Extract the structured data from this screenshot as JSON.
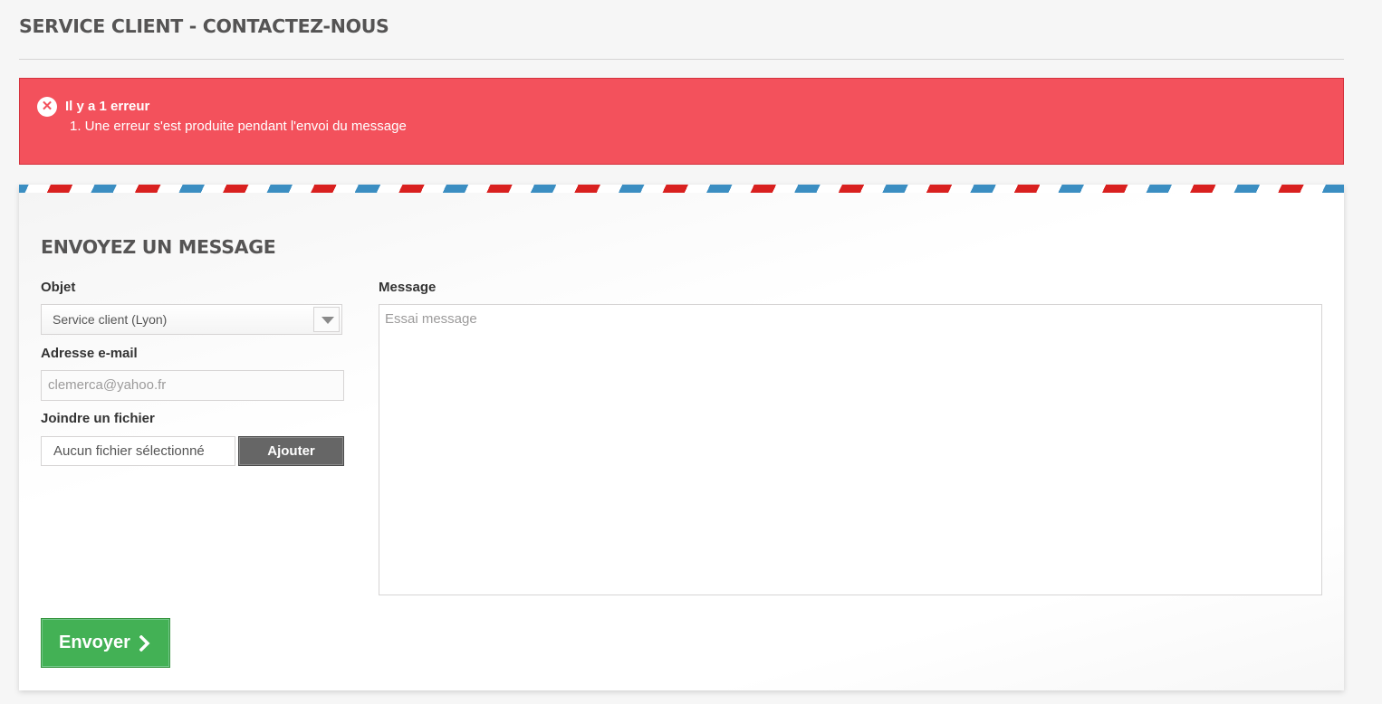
{
  "page": {
    "heading": "SERVICE CLIENT - CONTACTEZ-NOUS"
  },
  "alert": {
    "icon": "error-circle-icon",
    "title": "Il y a 1 erreur",
    "errors": [
      "1. Une erreur s'est produite pendant l'envoi du message"
    ],
    "color": "#f3515c"
  },
  "form": {
    "title": "ENVOYEZ UN MESSAGE",
    "subject": {
      "label": "Objet",
      "selected": "Service client (Lyon)"
    },
    "email": {
      "label": "Adresse e-mail",
      "value": "clemerca@yahoo.fr"
    },
    "attachment": {
      "label": "Joindre un fichier",
      "file_name": "Aucun fichier sélectionné",
      "button_label": "Ajouter"
    },
    "message": {
      "label": "Message",
      "value": "Essai message"
    },
    "submit": {
      "label": "Envoyer",
      "icon": "chevron-right-icon",
      "color": "#43b155"
    }
  }
}
